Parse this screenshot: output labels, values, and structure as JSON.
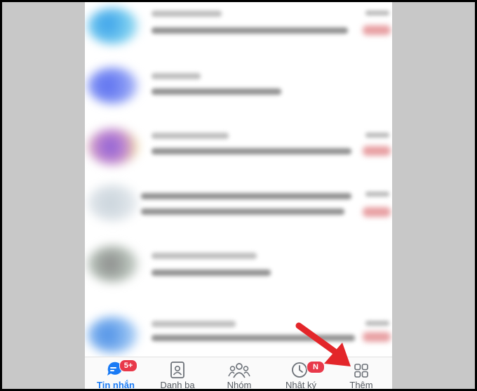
{
  "tabbar": {
    "tabs": [
      {
        "label": "Tin nhắn",
        "icon": "chat-bubble-icon",
        "badge": "5+",
        "active": true
      },
      {
        "label": "Danh bạ",
        "icon": "contact-card-icon",
        "active": false
      },
      {
        "label": "Nhóm",
        "icon": "group-people-icon",
        "active": false
      },
      {
        "label": "Nhật ký",
        "icon": "clock-icon",
        "badge": "N",
        "active": false
      },
      {
        "label": "Thêm",
        "icon": "grid-four-icon",
        "active": false
      }
    ]
  },
  "colors": {
    "accent": "#1a7bf5",
    "badge": "#e8394a",
    "annotation_arrow": "#e3262a",
    "backdrop": "#c8c8c8"
  },
  "annotation": {
    "icon": "red-arrow-icon",
    "target": "Thêm"
  }
}
